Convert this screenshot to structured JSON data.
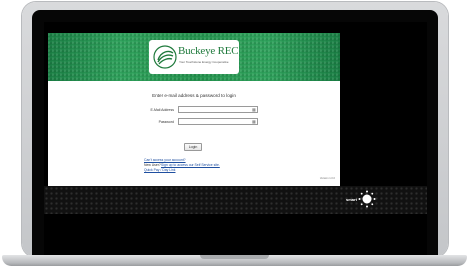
{
  "banner": {
    "logo_title": "Buckeye REC",
    "logo_tagline": "Your Touchstone Energy Cooperative"
  },
  "login": {
    "heading": "Enter e-mail address & password to login",
    "email_label": "E-Mail Address",
    "password_label": "Password",
    "login_button": "Login"
  },
  "links": {
    "cant_access": "Can't access your account?",
    "new_user_prefix": "New User?",
    "sign_up": "Sign up to access our Self Service site.",
    "quick_pay": "Quick Pay / Day Link"
  },
  "footer": {
    "version": "Version 1.0.0",
    "brand": "smart"
  },
  "colors": {
    "banner_green": "#20894d",
    "link_blue": "#1f4fa0"
  }
}
